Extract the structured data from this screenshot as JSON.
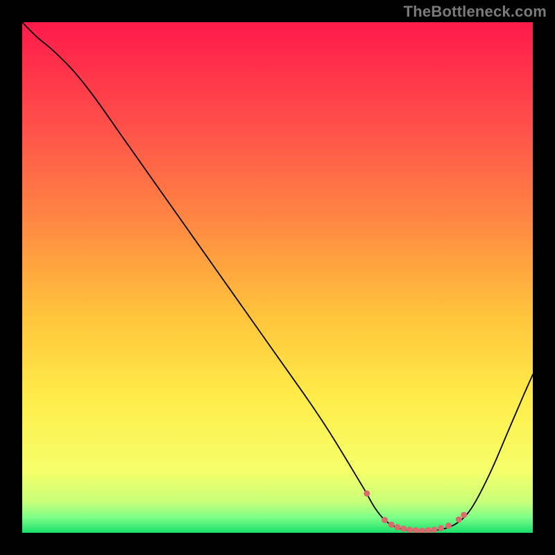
{
  "watermark": "TheBottleneck.com",
  "chart_data": {
    "type": "line",
    "title": "",
    "xlabel": "",
    "ylabel": "",
    "xlim": [
      0,
      100
    ],
    "ylim": [
      0,
      100
    ],
    "gradient_stops": [
      {
        "offset": 0.0,
        "color": "#ff1a4b"
      },
      {
        "offset": 0.2,
        "color": "#ff4f4a"
      },
      {
        "offset": 0.4,
        "color": "#ff8b42"
      },
      {
        "offset": 0.58,
        "color": "#ffc63b"
      },
      {
        "offset": 0.74,
        "color": "#ffed4a"
      },
      {
        "offset": 0.88,
        "color": "#f5ff6a"
      },
      {
        "offset": 0.94,
        "color": "#c8ff7a"
      },
      {
        "offset": 0.97,
        "color": "#7dff88"
      },
      {
        "offset": 1.0,
        "color": "#19e06a"
      }
    ],
    "series": [
      {
        "name": "bottleneck-curve",
        "color": "#000000",
        "points": [
          {
            "x": 0.0,
            "y": 100.0
          },
          {
            "x": 3.0,
            "y": 97.0
          },
          {
            "x": 6.0,
            "y": 94.5
          },
          {
            "x": 10.0,
            "y": 90.5
          },
          {
            "x": 14.0,
            "y": 85.5
          },
          {
            "x": 20.0,
            "y": 77.0
          },
          {
            "x": 26.0,
            "y": 68.5
          },
          {
            "x": 32.0,
            "y": 60.0
          },
          {
            "x": 38.0,
            "y": 51.5
          },
          {
            "x": 44.0,
            "y": 43.0
          },
          {
            "x": 50.0,
            "y": 34.5
          },
          {
            "x": 56.0,
            "y": 26.0
          },
          {
            "x": 60.0,
            "y": 20.0
          },
          {
            "x": 64.0,
            "y": 13.5
          },
          {
            "x": 67.0,
            "y": 8.5
          },
          {
            "x": 69.0,
            "y": 5.0
          },
          {
            "x": 71.0,
            "y": 2.5
          },
          {
            "x": 73.0,
            "y": 1.2
          },
          {
            "x": 75.0,
            "y": 0.6
          },
          {
            "x": 78.0,
            "y": 0.4
          },
          {
            "x": 81.0,
            "y": 0.5
          },
          {
            "x": 83.0,
            "y": 0.9
          },
          {
            "x": 85.0,
            "y": 1.8
          },
          {
            "x": 87.0,
            "y": 3.5
          },
          {
            "x": 89.0,
            "y": 6.5
          },
          {
            "x": 92.0,
            "y": 12.5
          },
          {
            "x": 95.0,
            "y": 19.5
          },
          {
            "x": 98.0,
            "y": 26.5
          },
          {
            "x": 100.0,
            "y": 31.0
          }
        ]
      },
      {
        "name": "highlight-dots",
        "color": "#d96a6e",
        "points": [
          {
            "x": 67.5,
            "y": 7.7
          },
          {
            "x": 71.0,
            "y": 2.5
          },
          {
            "x": 72.3,
            "y": 1.6
          },
          {
            "x": 73.5,
            "y": 1.1
          },
          {
            "x": 74.7,
            "y": 0.8
          },
          {
            "x": 75.9,
            "y": 0.6
          },
          {
            "x": 77.1,
            "y": 0.5
          },
          {
            "x": 78.3,
            "y": 0.4
          },
          {
            "x": 79.5,
            "y": 0.5
          },
          {
            "x": 80.7,
            "y": 0.6
          },
          {
            "x": 82.0,
            "y": 0.9
          },
          {
            "x": 83.5,
            "y": 1.4
          },
          {
            "x": 85.5,
            "y": 2.6
          },
          {
            "x": 86.5,
            "y": 3.5
          }
        ]
      }
    ]
  }
}
